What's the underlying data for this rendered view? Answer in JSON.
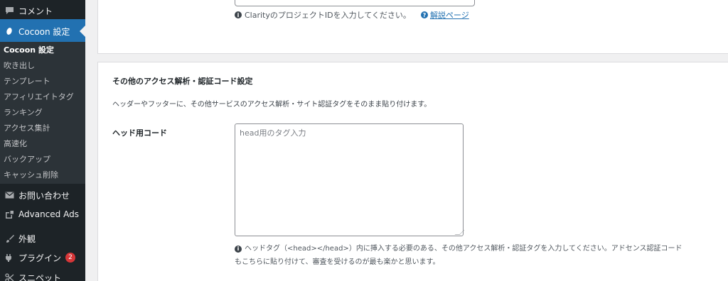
{
  "sidebar": {
    "comments": {
      "label": "コメント",
      "icon": "comment-icon"
    },
    "cocoon": {
      "label": "Cocoon 設定",
      "icon": "cocoon-icon"
    },
    "submenu": [
      {
        "label": "Cocoon 設定"
      },
      {
        "label": "吹き出し"
      },
      {
        "label": "テンプレート"
      },
      {
        "label": "アフィリエイトタグ"
      },
      {
        "label": "ランキング"
      },
      {
        "label": "アクセス集計"
      },
      {
        "label": "高速化"
      },
      {
        "label": "バックアップ"
      },
      {
        "label": "キャッシュ削除"
      }
    ],
    "contact": {
      "label": "お問い合わせ",
      "icon": "mail-icon"
    },
    "ads": {
      "label": "Advanced Ads",
      "icon": "ads-icon"
    },
    "appearance": {
      "label": "外観",
      "icon": "brush-icon"
    },
    "plugins": {
      "label": "プラグイン",
      "icon": "plugin-icon",
      "badge": "2"
    },
    "snippets": {
      "label": "スニペット",
      "icon": "scissors-icon"
    }
  },
  "clarity": {
    "hint": "ClarityのプロジェクトIDを入力してください。",
    "help_link": "解説ページ"
  },
  "other_analytics": {
    "title": "その他のアクセス解析・認証コード設定",
    "description": "ヘッダーやフッターに、その他サービスのアクセス解析・サイト認証タグをそのまま貼り付けます。",
    "head_code_label": "ヘッド用コード",
    "head_code_placeholder": "head用のタグ入力",
    "head_code_value": "",
    "hint_line1": "ヘッドタグ（<head></head>）内に挿入する必要のある、その他アクセス解析・認証タグを入力してください。アドセンス認証コード",
    "hint_line2": "もこちらに貼り付けて、審査を受けるのが最も楽かと思います。"
  },
  "colors": {
    "sidebar_bg": "#1d2327",
    "submenu_bg": "#2c3338",
    "accent": "#2271b1",
    "badge": "#d63638"
  }
}
